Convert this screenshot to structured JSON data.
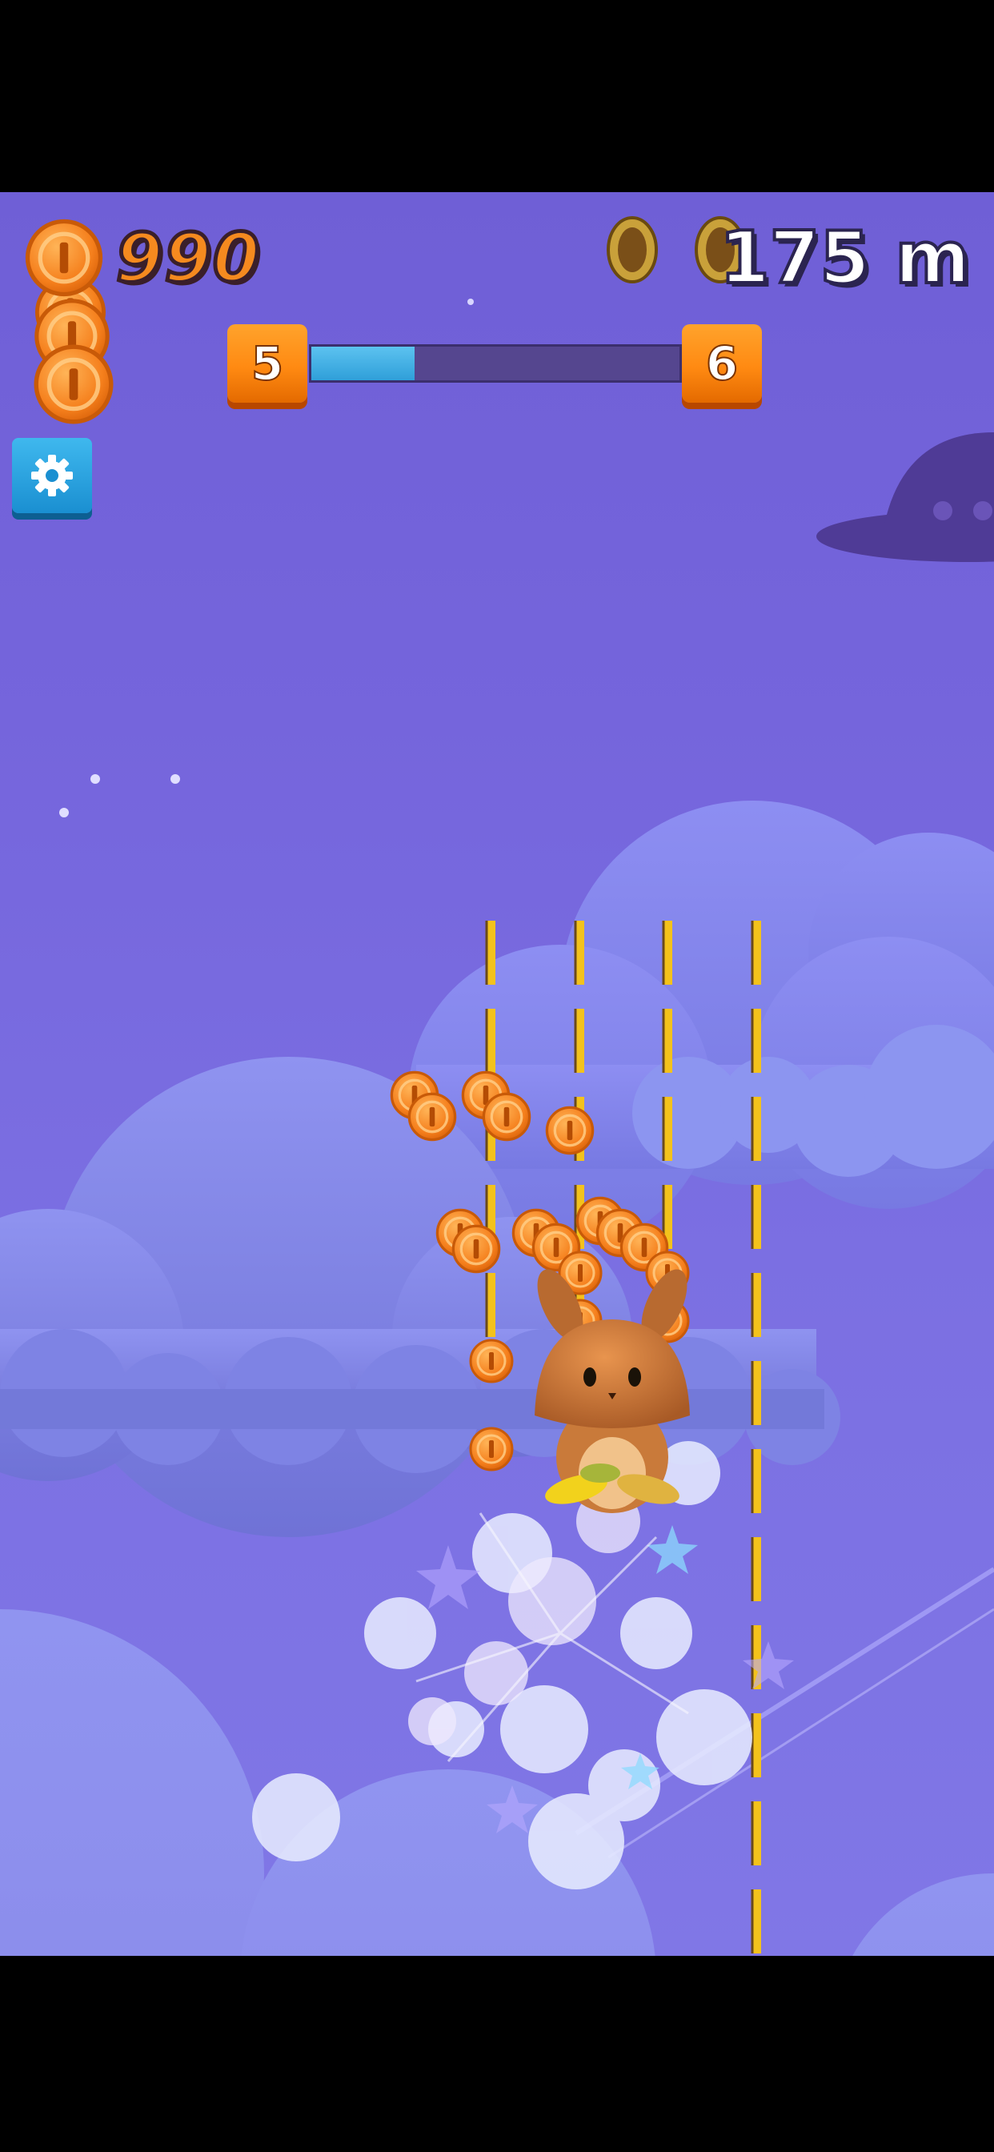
{
  "hud": {
    "coin_count": "990",
    "coin_icon": "coin-icon",
    "distance": "175 m"
  },
  "level": {
    "current": "5",
    "next": "6",
    "progress_fraction": 0.28
  },
  "settings": {
    "icon": "gear-icon"
  },
  "colors": {
    "sky": "#7565dc",
    "coin_orange": "#f58a1f",
    "level_box": "#ff8a12",
    "progress_fill": "#2f9fd9",
    "settings_button": "#1a8fd1",
    "rail_yellow": "#f3c21c"
  }
}
